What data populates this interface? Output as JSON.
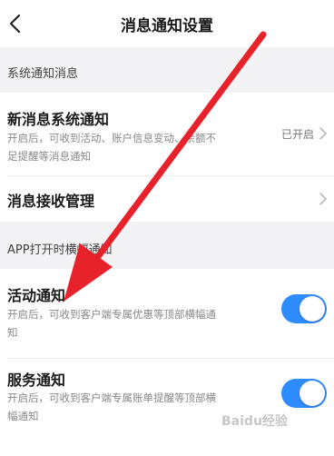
{
  "header": {
    "title": "消息通知设置",
    "back_icon": "chevron-left-icon"
  },
  "sections": {
    "system": {
      "label": "系统通知消息"
    },
    "app_banner": {
      "label": "APP打开时横幅通知"
    }
  },
  "items": {
    "new_system": {
      "title": "新消息系统通知",
      "desc": "开启后，可收到活动、账户信息变动、余额不足提醒等消息通知",
      "status": "已开启"
    },
    "receive_mgmt": {
      "title": "消息接收管理"
    },
    "activity": {
      "title": "活动通知",
      "desc": "开启后，可收到客户端专属优惠等顶部横幅通知",
      "enabled": true
    },
    "service": {
      "title": "服务通知",
      "desc": "开启后，可收到客户端专属账单提醒等顶部横幅通知",
      "enabled": true
    }
  },
  "colors": {
    "accent": "#2f8cff",
    "annotation_arrow": "#e8222b"
  },
  "watermark": "Baidu经验"
}
